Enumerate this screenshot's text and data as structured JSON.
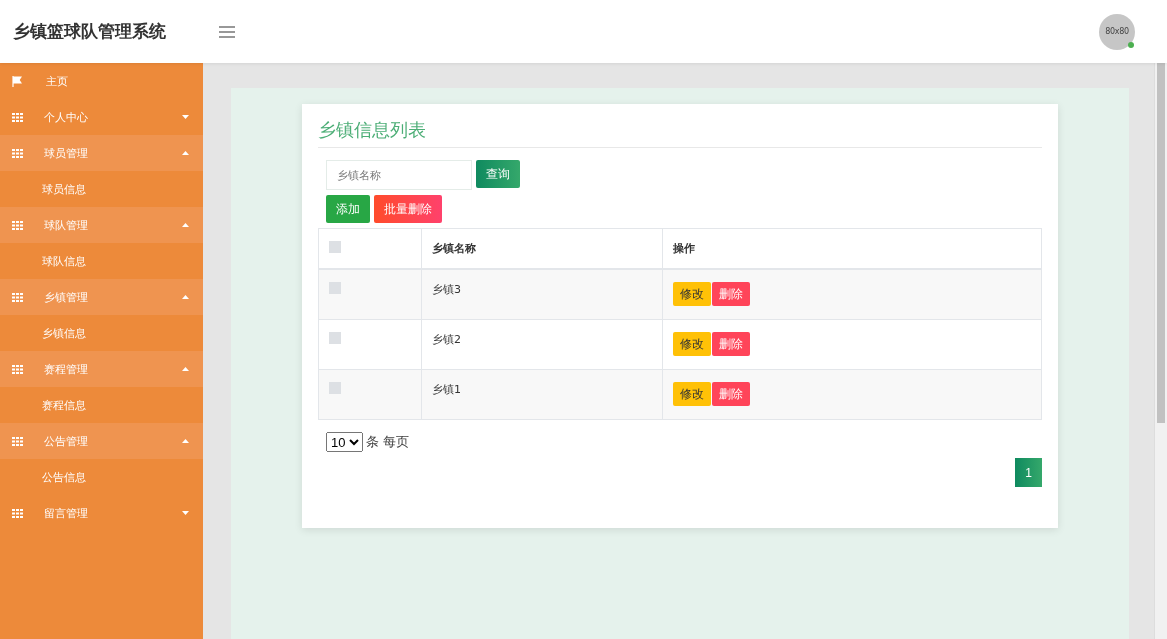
{
  "header": {
    "title": "乡镇篮球队管理系统",
    "avatar": {
      "label": "80x80",
      "online": true
    }
  },
  "sidebar": {
    "items": [
      {
        "kind": "link",
        "label": "主页"
      },
      {
        "kind": "group",
        "label": "个人中心",
        "expanded": false
      },
      {
        "kind": "group",
        "label": "球员管理",
        "expanded": true,
        "children": [
          {
            "label": "球员信息"
          }
        ]
      },
      {
        "kind": "group",
        "label": "球队管理",
        "expanded": true,
        "children": [
          {
            "label": "球队信息"
          }
        ]
      },
      {
        "kind": "group",
        "label": "乡镇管理",
        "expanded": true,
        "children": [
          {
            "label": "乡镇信息"
          }
        ]
      },
      {
        "kind": "group",
        "label": "赛程管理",
        "expanded": true,
        "children": [
          {
            "label": "赛程信息"
          }
        ]
      },
      {
        "kind": "group",
        "label": "公告管理",
        "expanded": true,
        "children": [
          {
            "label": "公告信息"
          }
        ]
      },
      {
        "kind": "group",
        "label": "留言管理",
        "expanded": false
      }
    ]
  },
  "card": {
    "title": "乡镇信息列表",
    "search": {
      "placeholder": "乡镇名称",
      "button": "查询"
    },
    "toolbar": [
      {
        "label": "添加",
        "kind": "add"
      },
      {
        "label": "批量删除",
        "kind": "delete"
      }
    ],
    "table": {
      "columns": [
        "乡镇名称",
        "操作"
      ],
      "header_checked": false,
      "rows": [
        {
          "checked": false,
          "name": "乡镇3",
          "actions": [
            {
              "label": "修改",
              "kind": "edit"
            },
            {
              "label": "删除",
              "kind": "delete"
            }
          ]
        },
        {
          "checked": false,
          "name": "乡镇2",
          "actions": [
            {
              "label": "修改",
              "kind": "edit"
            },
            {
              "label": "删除",
              "kind": "delete"
            }
          ]
        },
        {
          "checked": false,
          "name": "乡镇1",
          "actions": [
            {
              "label": "修改",
              "kind": "edit"
            },
            {
              "label": "删除",
              "kind": "delete"
            }
          ]
        }
      ]
    },
    "page_size": {
      "value": "10",
      "label": "条 每页"
    },
    "pages": [
      {
        "label": "1",
        "selected": true
      }
    ]
  }
}
